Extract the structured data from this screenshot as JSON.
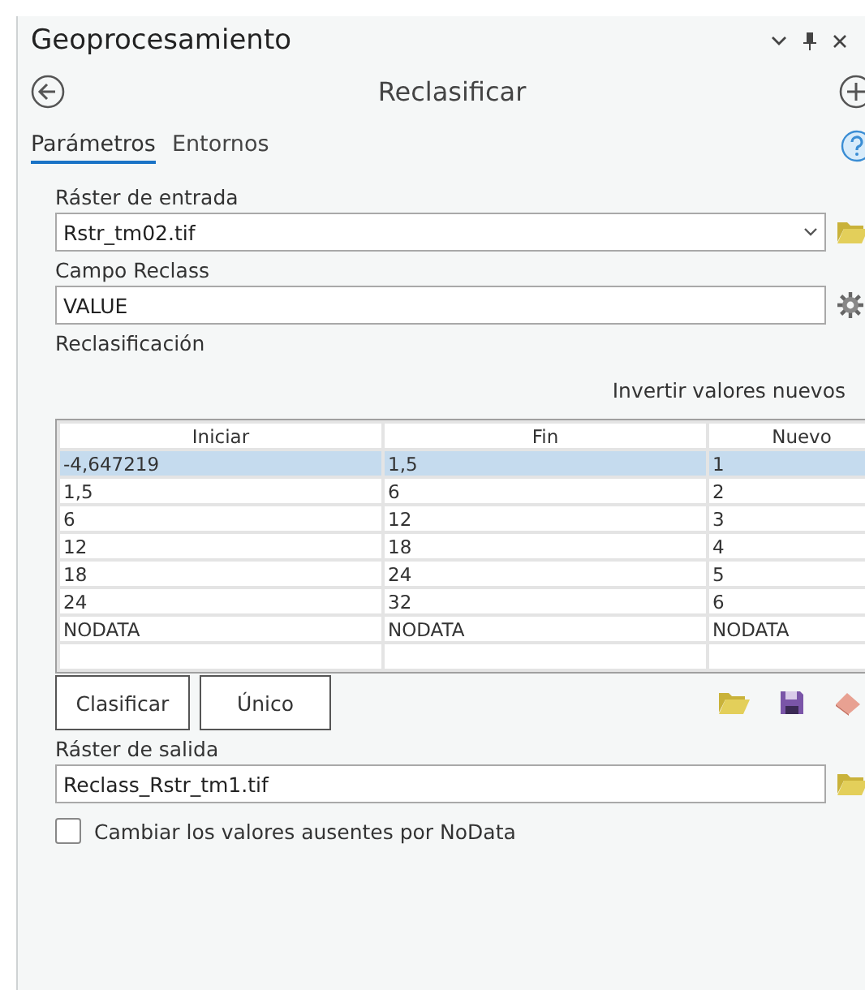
{
  "pane": {
    "title": "Geoprocesamiento"
  },
  "tool": {
    "title": "Reclasificar"
  },
  "tabs": [
    {
      "label": "Parámetros",
      "selected": true
    },
    {
      "label": "Entornos",
      "selected": false
    }
  ],
  "input_raster": {
    "label": "Ráster de entrada",
    "value": "Rstr_tm02.tif"
  },
  "reclass_field": {
    "label": "Campo Reclass",
    "value": "VALUE"
  },
  "reclassification": {
    "label": "Reclasificación",
    "reverse_link": "Invertir valores nuevos",
    "table": {
      "columns": [
        "Iniciar",
        "Fin",
        "Nuevo"
      ],
      "rows": [
        {
          "cells": [
            "-4,647219",
            "1,5",
            "1"
          ],
          "selected": true
        },
        {
          "cells": [
            "1,5",
            "6",
            "2"
          ],
          "selected": false
        },
        {
          "cells": [
            "6",
            "12",
            "3"
          ],
          "selected": false
        },
        {
          "cells": [
            "12",
            "18",
            "4"
          ],
          "selected": false
        },
        {
          "cells": [
            "18",
            "24",
            "5"
          ],
          "selected": false
        },
        {
          "cells": [
            "24",
            "32",
            "6"
          ],
          "selected": false
        },
        {
          "cells": [
            "NODATA",
            "NODATA",
            "NODATA"
          ],
          "selected": false
        }
      ]
    },
    "buttons": [
      "Clasificar",
      "Único"
    ]
  },
  "output_raster": {
    "label": "Ráster de salida",
    "value": "Reclass_Rstr_tm1.tif"
  },
  "missing_to_nodata": {
    "label": "Cambiar los valores ausentes por NoData",
    "checked": false
  }
}
